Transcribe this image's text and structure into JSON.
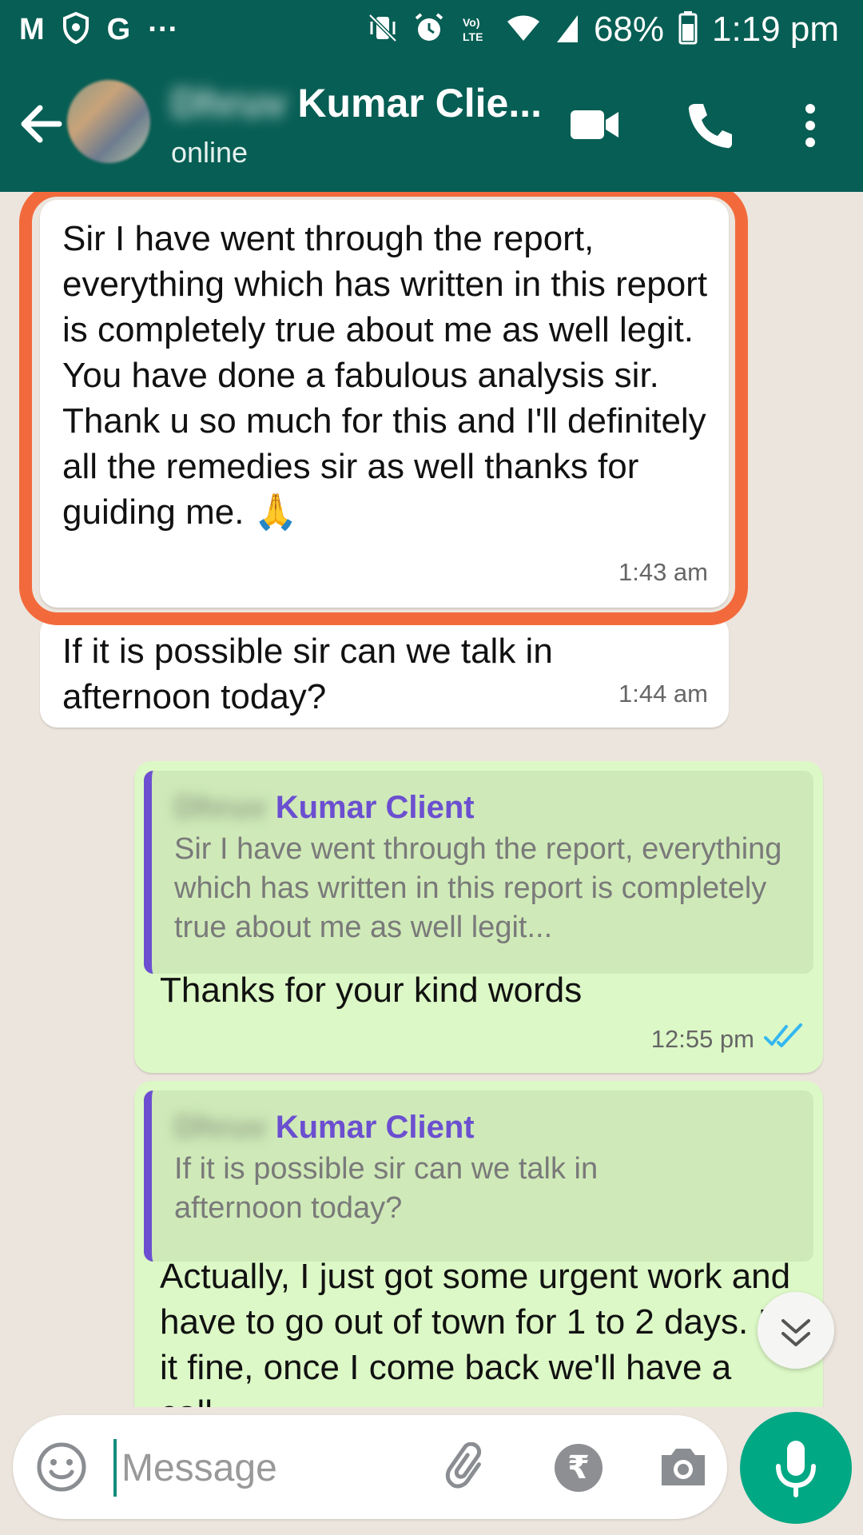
{
  "status_bar": {
    "left_icons": [
      "m-logo-icon",
      "shield-icon",
      "google-icon",
      "more-notifications-icon"
    ],
    "icon_glyphs": {
      "m": "M",
      "g": "G",
      "more": "···"
    },
    "right_icons": [
      "vibrate-icon",
      "alarm-icon",
      "volte-icon",
      "wifi-icon",
      "signal-icon",
      "battery-icon"
    ],
    "battery": "68%",
    "time": "1:19 pm"
  },
  "header": {
    "contact_name_visible": "Kumar Clie...",
    "contact_status": "online",
    "icons": [
      "back-arrow-icon",
      "video-call-icon",
      "phone-icon",
      "more-vert-icon"
    ]
  },
  "messages": [
    {
      "direction": "incoming",
      "text": "Sir I have went through the report, everything which has written in this report is completely true about me as well legit. You have done a fabulous analysis sir. Thank u so much for this and I'll definitely all the remedies sir as well thanks for guiding me. 🙏",
      "time": "1:43 am",
      "highlighted": true,
      "highlight_color": "#f26a3c"
    },
    {
      "direction": "incoming",
      "text": "If it is possible sir can we talk in afternoon today?",
      "time": "1:44 am"
    },
    {
      "direction": "outgoing",
      "quote": {
        "name": "Kumar Client",
        "text": "Sir I have went through the report, everything which has written in this report is completely true about me as well legit..."
      },
      "text": "Thanks for your kind words",
      "time": "12:55 pm",
      "read_receipt": "double-tick-icon"
    },
    {
      "direction": "outgoing",
      "quote": {
        "name": "Kumar Client",
        "text": "If it is possible sir can we talk in afternoon today?"
      },
      "text": "Actually, I just got some urgent work and have to go out of town for 1 to 2 days. Is it fine, once I come back we'll have a call."
    }
  ],
  "composer": {
    "placeholder": "Message",
    "icons": [
      "emoji-icon",
      "attach-icon",
      "rupee-payment-icon",
      "camera-icon",
      "mic-icon"
    ],
    "rupee_glyph": "₹"
  },
  "colors": {
    "header_bg": "#075e54",
    "chat_bg": "#ece5dd",
    "incoming_bubble": "#ffffff",
    "outgoing_bubble": "#dcf8c6",
    "quote_accent": "#6b4fd0",
    "mic_button": "#00a884",
    "read_tick": "#34b7f1"
  }
}
